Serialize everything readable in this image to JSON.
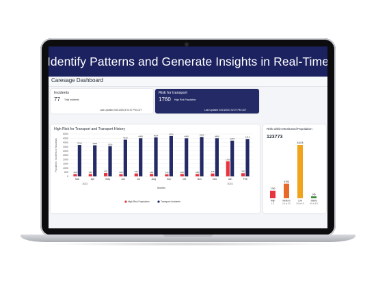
{
  "banner": {
    "title": "Identify Patterns and Generate Insights in Real-Time"
  },
  "app": {
    "title": "Caresage Dashboard"
  },
  "incidents_card": {
    "label": "Incidents",
    "value": "77",
    "unit": "Total Incidents",
    "updated": "Last Updated 03/13/2023 02:07 PM CDT"
  },
  "risk_card": {
    "label": "Risk for transport",
    "value": "1760",
    "unit": "High Risk Population",
    "updated": "Last Updated 03/13/2023 02:07 PM CDT"
  },
  "colors": {
    "banner": "#1c2260",
    "navy": "#232a66",
    "red": "#e8343e",
    "orange": "#f0a31c",
    "green": "#3c8a3c"
  },
  "chart_data": [
    {
      "type": "bar",
      "title": "High Risk for Transport and Transport History",
      "xlabel": "Months",
      "ylabel": "Population / Incidents in thousands",
      "ylim": [
        0,
        5000
      ],
      "yticks": [
        "0",
        "500",
        "1000",
        "1500",
        "2000",
        "2500",
        "3000",
        "3500",
        "4000",
        "4500",
        "5000"
      ],
      "categories": [
        "Mar",
        "Apr",
        "May",
        "Jun",
        "Jul",
        "Aug",
        "Sep",
        "Oct",
        "Nov",
        "Dec",
        "Jan",
        "Feb"
      ],
      "year_labels": [
        "2022",
        "2023"
      ],
      "series": [
        {
          "name": "High Risk Population",
          "values": [
            268,
            285,
            402,
            260,
            347,
            290,
            240,
            288,
            280,
            345,
            1780,
            380
          ],
          "labels": [
            "268",
            "285",
            "402",
            "260",
            "347",
            "290",
            "240",
            "288",
            "280",
            "345",
            "1780",
            "380"
          ]
        },
        {
          "name": "Transport Incidents",
          "values": [
            3704,
            3668,
            3556,
            4330,
            4496,
            4604,
            4766,
            4490,
            4650,
            4496,
            4218,
            4410
          ],
          "labels": [
            "3704",
            "3668",
            "3556",
            "4330",
            "4496",
            "4604",
            "4766",
            "4490",
            "4650",
            "4496",
            "4218",
            "4410"
          ]
        }
      ],
      "legend": "bottom"
    },
    {
      "type": "bar",
      "title": "Risk within Monitored Population",
      "total": "123773",
      "categories": [
        "High",
        "Medium",
        "Low",
        "Stable"
      ],
      "category_ranges": [
        "1.0",
        "2.0 to 3.0",
        "3.0 to 4.0",
        "4.0 to 5.0"
      ],
      "values": [
        1760,
        5795,
        61078,
        146
      ]
    }
  ]
}
